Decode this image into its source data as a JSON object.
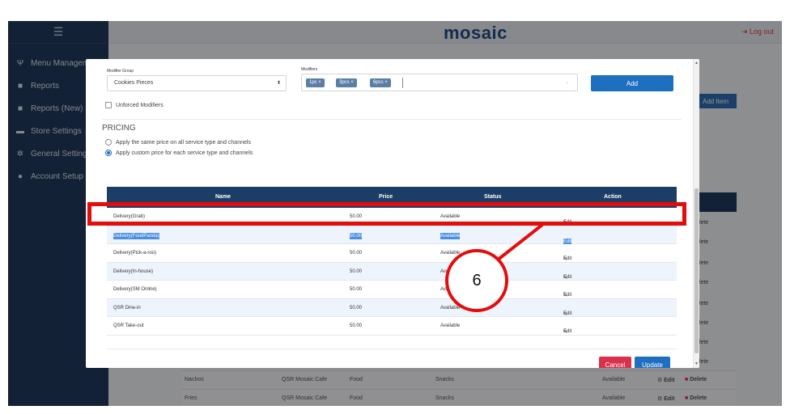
{
  "app": {
    "logo": "mosaic",
    "logout_label": "Log out",
    "sidebar": [
      {
        "icon": "fork-knife-icon",
        "glyph": "Ψ",
        "label": "Menu Management"
      },
      {
        "icon": "report-icon",
        "glyph": "■",
        "label": "Reports"
      },
      {
        "icon": "report-icon",
        "glyph": "■",
        "label": "Reports (New)"
      },
      {
        "icon": "store-icon",
        "glyph": "▬",
        "label": "Store Settings"
      },
      {
        "icon": "gear-icon",
        "glyph": "✲",
        "label": "General Settings"
      },
      {
        "icon": "user-icon",
        "glyph": "●",
        "label": "Account Setup"
      }
    ],
    "add_item_label": "Add Item",
    "bg_delete_label": "elete",
    "bg_rows": [
      {
        "name": "Nachos",
        "store": "QSR Mosaic Cafe",
        "type": "Food",
        "category": "Snacks",
        "status": "Available",
        "edit": "Edit",
        "delete": "Delete"
      },
      {
        "name": "Fries",
        "store": "QSR Mosaic Cafe",
        "type": "Food",
        "category": "Snacks",
        "status": "Available",
        "edit": "Edit",
        "delete": "Delete"
      }
    ]
  },
  "modal": {
    "modifier_group_label": "Modifier Group",
    "modifier_group_value": "Cookies Pieces",
    "modifiers_label": "Modifiers",
    "modifier_chips": [
      "1pc",
      "3pcs",
      "6pcs"
    ],
    "add_label": "Add",
    "unforced_label": "Unforced Modifiers",
    "pricing_title": "PRICING",
    "radio_same": "Apply the same price on all service type and channels",
    "radio_custom": "Apply custom price for each service type and channels",
    "table": {
      "headers": [
        "Name",
        "Price",
        "Status",
        "Action"
      ],
      "rows": [
        {
          "name": "Delivery(Grab)",
          "price": "50.00",
          "status": "Available",
          "action": "Edit"
        },
        {
          "name": "Delivery(FoodPanda)",
          "price": "50.00",
          "status": "Available",
          "action": "Edit"
        },
        {
          "name": "Delivery(Pick-a-roo)",
          "price": "50.00",
          "status": "Available",
          "action": "Edit"
        },
        {
          "name": "Delivery(In-house)",
          "price": "50.00",
          "status": "Available",
          "action": "Edit"
        },
        {
          "name": "Delivery(SM Online)",
          "price": "50.00",
          "status": "Available",
          "action": "Edit"
        },
        {
          "name": "QSR Dine-in",
          "price": "50.00",
          "status": "Available",
          "action": "Edit"
        },
        {
          "name": "QSR Take-out",
          "price": "50.00",
          "status": "Available",
          "action": "Edit"
        }
      ]
    },
    "cancel_label": "Cancel",
    "update_label": "Update"
  },
  "annotation": {
    "step_number": "6",
    "color": "#e40d0d"
  }
}
